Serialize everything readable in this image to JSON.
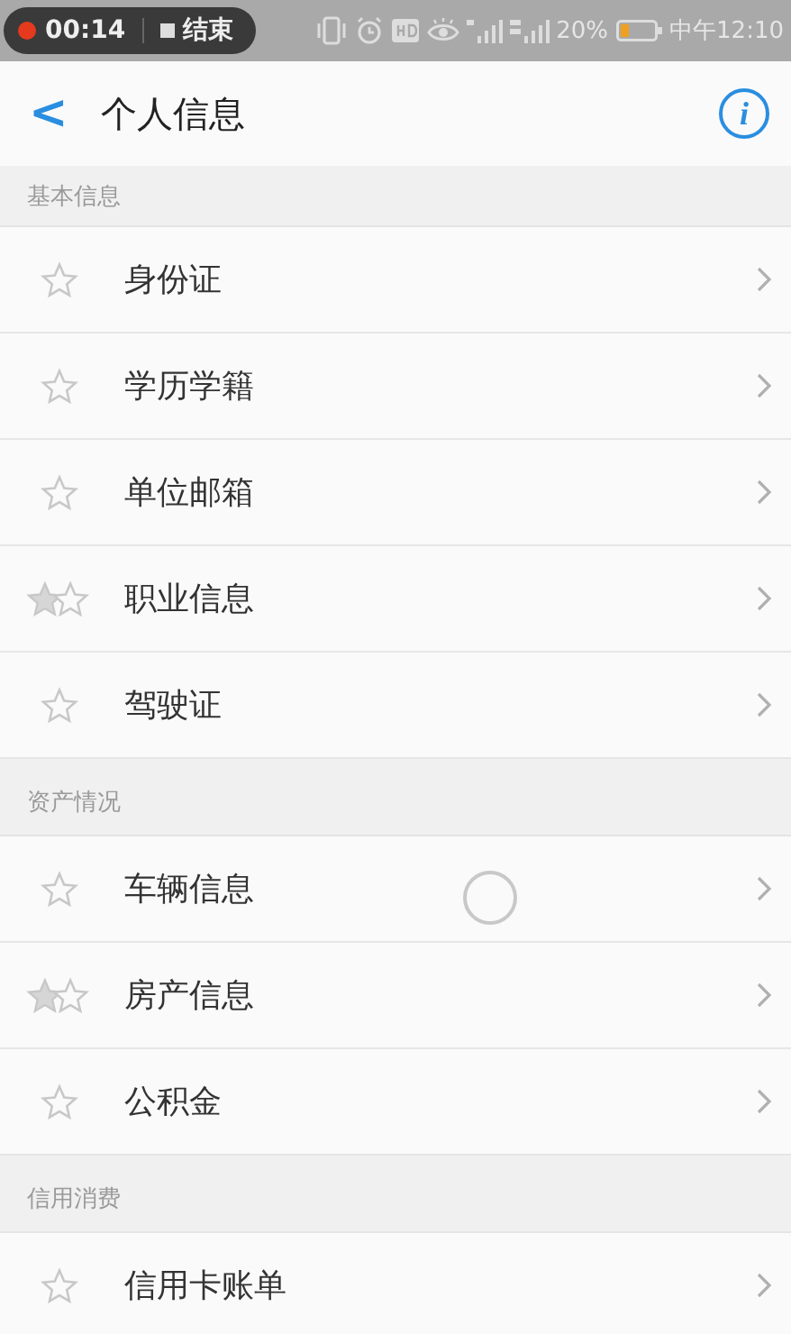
{
  "status_bar": {
    "recording_time": "00:14",
    "stop_label": "结束",
    "battery": "20%",
    "time": "中午12:10"
  },
  "header": {
    "back": "<",
    "title": "个人信息",
    "info": "i"
  },
  "sections": [
    {
      "title": "基本信息",
      "items": [
        {
          "label": "身份证",
          "kind": "single"
        },
        {
          "label": "学历学籍",
          "kind": "single"
        },
        {
          "label": "单位邮箱",
          "kind": "single"
        },
        {
          "label": "职业信息",
          "kind": "double"
        },
        {
          "label": "驾驶证",
          "kind": "single"
        }
      ]
    },
    {
      "title": "资产情况",
      "items": [
        {
          "label": "车辆信息",
          "kind": "single"
        },
        {
          "label": "房产信息",
          "kind": "double"
        },
        {
          "label": "公积金",
          "kind": "single"
        }
      ]
    },
    {
      "title": "信用消费",
      "items": [
        {
          "label": "信用卡账单",
          "kind": "single"
        }
      ]
    }
  ]
}
